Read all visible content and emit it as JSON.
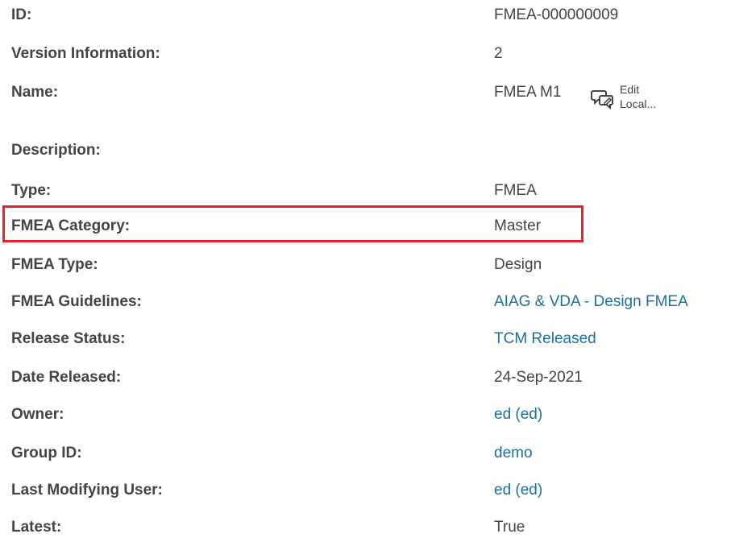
{
  "properties": [
    {
      "label": "ID:",
      "value": "FMEA-000000009",
      "is_link": false
    },
    {
      "label": "Version Information:",
      "value": "2",
      "is_link": false
    },
    {
      "label": "Name:",
      "value": "FMEA M1",
      "is_link": false
    },
    {
      "label": "Description:",
      "value": "",
      "is_link": false
    },
    {
      "label": "Type:",
      "value": "FMEA",
      "is_link": false
    },
    {
      "label": "FMEA Category:",
      "value": "Master",
      "is_link": false
    },
    {
      "label": "FMEA Type:",
      "value": "Design",
      "is_link": false
    },
    {
      "label": "FMEA Guidelines:",
      "value": "AIAG & VDA - Design FMEA",
      "is_link": true
    },
    {
      "label": "Release Status:",
      "value": "TCM Released",
      "is_link": true
    },
    {
      "label": "Date Released:",
      "value": "24-Sep-2021",
      "is_link": false
    },
    {
      "label": "Owner:",
      "value": "ed (ed)",
      "is_link": true
    },
    {
      "label": "Group ID:",
      "value": "demo",
      "is_link": true
    },
    {
      "label": "Last Modifying User:",
      "value": "ed (ed)",
      "is_link": true
    },
    {
      "label": "Latest:",
      "value": "True",
      "is_link": false
    }
  ],
  "edit_local": {
    "line1": "Edit",
    "line2": "Local...",
    "icon": "speech-bubbles-edit-icon"
  },
  "colors": {
    "link": "#1e6f9f",
    "text": "#444444",
    "highlight": "#e8202a"
  }
}
